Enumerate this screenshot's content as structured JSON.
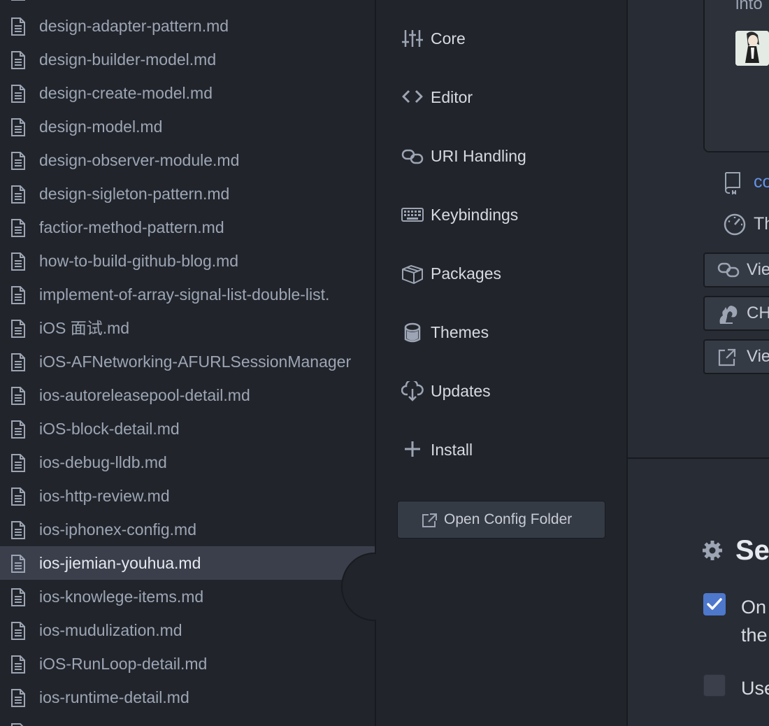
{
  "file_tree": {
    "files": [
      "design-adapter-pattern.md",
      "design-builder-model.md",
      "design-create-model.md",
      "design-model.md",
      "design-observer-module.md",
      "design-sigleton-pattern.md",
      "factior-method-pattern.md",
      "how-to-build-github-blog.md",
      "implement-of-array-signal-list-double-list.",
      "iOS 面试.md",
      "iOS-AFNetworking-AFURLSessionManager",
      "ios-autoreleasepool-detail.md",
      "iOS-block-detail.md",
      "ios-debug-lldb.md",
      "ios-http-review.md",
      "ios-iphonex-config.md",
      "ios-jiemian-youhua.md",
      "ios-knowlege-items.md",
      "ios-mudulization.md",
      "iOS-RunLoop-detail.md",
      "ios-runtime-detail.md"
    ],
    "selected": "ios-jiemian-youhua.md"
  },
  "settings_menu": {
    "items": [
      {
        "label": "Core",
        "icon": "sliders-icon"
      },
      {
        "label": "Editor",
        "icon": "code-icon"
      },
      {
        "label": "URI Handling",
        "icon": "link-icon"
      },
      {
        "label": "Keybindings",
        "icon": "keyboard-icon"
      },
      {
        "label": "Packages",
        "icon": "package-icon"
      },
      {
        "label": "Themes",
        "icon": "paintcan-icon"
      },
      {
        "label": "Updates",
        "icon": "cloud-download-icon"
      },
      {
        "label": "Install",
        "icon": "plus-icon"
      }
    ],
    "open_config_folder": "Open Config Folder"
  },
  "package_panel": {
    "card_text": "into",
    "repo_link": "co",
    "info_text": "Th",
    "buttons": [
      "Vie",
      "CH",
      "Viev"
    ],
    "section_title": "Se",
    "option1_line1": "On",
    "option1_line2": "the",
    "option2": "Use"
  },
  "colors": {
    "accent": "#4d78cc",
    "link": "#6494ed",
    "tree_bg": "#21252b",
    "panel_bg": "#282c34",
    "selected_bg": "#3a3f4b"
  }
}
